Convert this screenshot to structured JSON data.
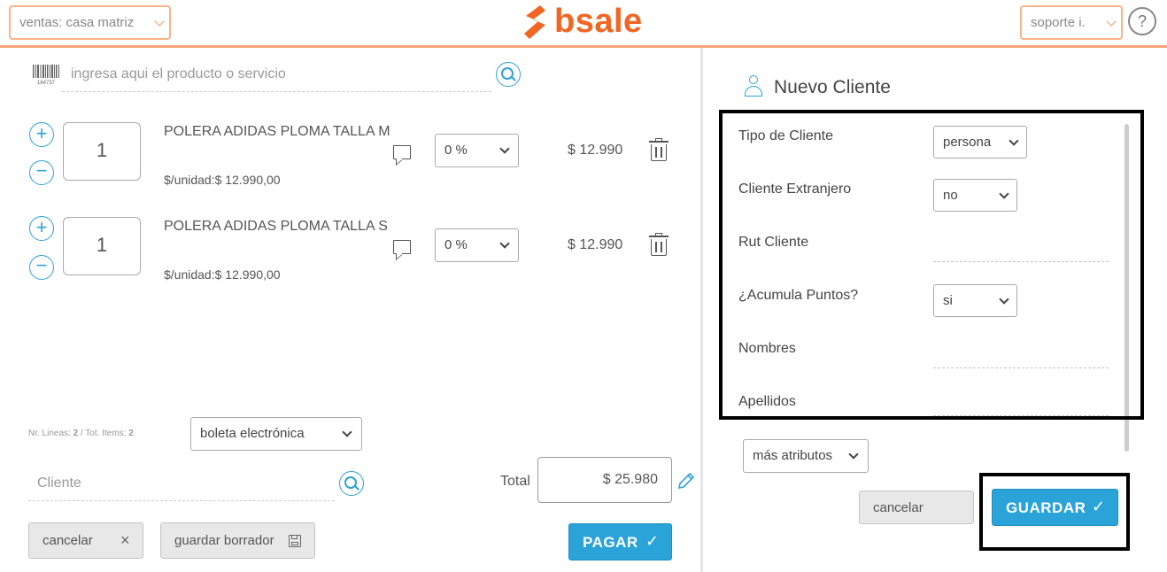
{
  "header": {
    "branch_select": "ventas: casa matriz",
    "logo_text": "bsale",
    "user_select": "soporte i.",
    "help": "?"
  },
  "product_search": {
    "placeholder": "ingresa aqui el producto o servicio"
  },
  "items": [
    {
      "qty": "1",
      "name": "POLERA ADIDAS PLOMA TALLA M",
      "unit_price": "$/unidad:$ 12.990,00",
      "discount": "0 %",
      "total": "$ 12.990"
    },
    {
      "qty": "1",
      "name": "POLERA ADIDAS PLOMA TALLA S",
      "unit_price": "$/unidad:$ 12.990,00",
      "discount": "0 %",
      "total": "$ 12.990"
    }
  ],
  "summary": {
    "lines_label": "Nr. Lineas: ",
    "lines_value": "2",
    "items_label": " / Tot. Items: ",
    "items_value": "2",
    "document_type": "boleta electrónica",
    "client_placeholder": "Cliente",
    "total_label": "Total",
    "total_value": "$ 25.980"
  },
  "actions": {
    "cancel": "cancelar",
    "save_draft": "guardar borrador",
    "pay": "PAGAR"
  },
  "new_client": {
    "title": "Nuevo Cliente",
    "fields": {
      "client_type_label": "Tipo de Cliente",
      "client_type_value": "persona",
      "foreign_label": "Cliente Extranjero",
      "foreign_value": "no",
      "rut_label": "Rut Cliente",
      "points_label": "¿Acumula Puntos?",
      "points_value": "si",
      "names_label": "Nombres",
      "surnames_label": "Apellidos"
    },
    "more_attributes": "más atributos",
    "cancel": "cancelar",
    "save": "GUARDAR"
  },
  "colors": {
    "accent_orange": "#f29a66",
    "accent_blue": "#2aa3d8"
  }
}
